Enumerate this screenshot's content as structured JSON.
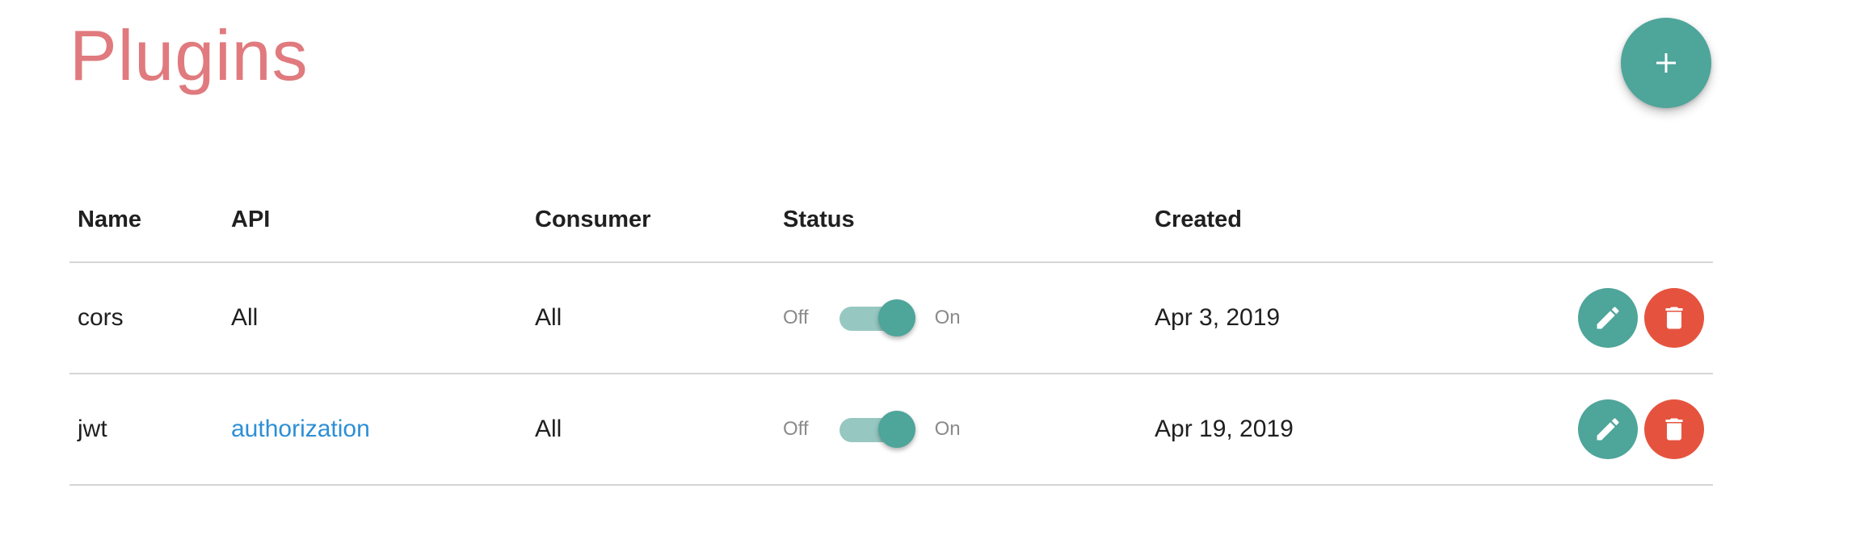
{
  "page": {
    "title": "Plugins"
  },
  "add_button": {
    "icon": "plus-icon"
  },
  "table": {
    "headers": {
      "name": "Name",
      "api": "API",
      "consumer": "Consumer",
      "status": "Status",
      "created": "Created"
    },
    "rows": [
      {
        "name": "cors",
        "api": "All",
        "api_is_link": false,
        "consumer": "All",
        "status_off": "Off",
        "status_on": "On",
        "enabled": true,
        "created": "Apr 3, 2019"
      },
      {
        "name": "jwt",
        "api": "authorization",
        "api_is_link": true,
        "consumer": "All",
        "status_off": "Off",
        "status_on": "On",
        "enabled": true,
        "created": "Apr 19, 2019"
      }
    ]
  },
  "colors": {
    "title": "#e07a7e",
    "accent": "#4ea59a",
    "accent_light": "#97c7c1",
    "danger": "#e5533f",
    "link": "#2d8fd5"
  }
}
